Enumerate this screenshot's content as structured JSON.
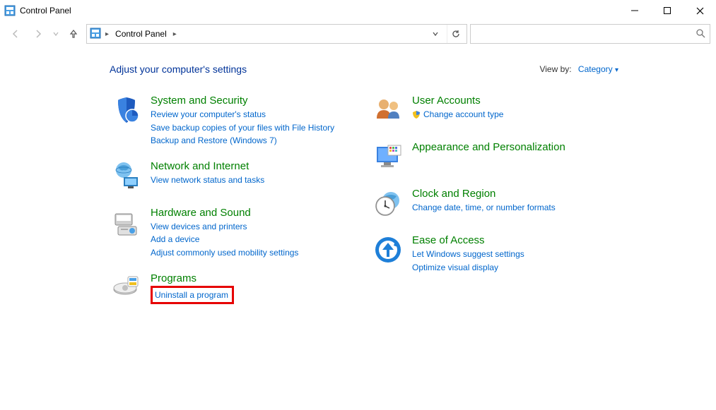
{
  "titlebar": {
    "title": "Control Panel"
  },
  "breadcrumb": {
    "root": "Control Panel"
  },
  "search": {
    "placeholder": ""
  },
  "heading": "Adjust your computer's settings",
  "viewby": {
    "label": "View by:",
    "value": "Category"
  },
  "left": [
    {
      "title": "System and Security",
      "links": [
        "Review your computer's status",
        "Save backup copies of your files with File History",
        "Backup and Restore (Windows 7)"
      ]
    },
    {
      "title": "Network and Internet",
      "links": [
        "View network status and tasks"
      ]
    },
    {
      "title": "Hardware and Sound",
      "links": [
        "View devices and printers",
        "Add a device",
        "Adjust commonly used mobility settings"
      ]
    },
    {
      "title": "Programs",
      "links": [
        "Uninstall a program"
      ]
    }
  ],
  "right": [
    {
      "title": "User Accounts",
      "links": [
        "Change account type"
      ],
      "shield_first": true
    },
    {
      "title": "Appearance and Personalization",
      "links": []
    },
    {
      "title": "Clock and Region",
      "links": [
        "Change date, time, or number formats"
      ]
    },
    {
      "title": "Ease of Access",
      "links": [
        "Let Windows suggest settings",
        "Optimize visual display"
      ]
    }
  ]
}
